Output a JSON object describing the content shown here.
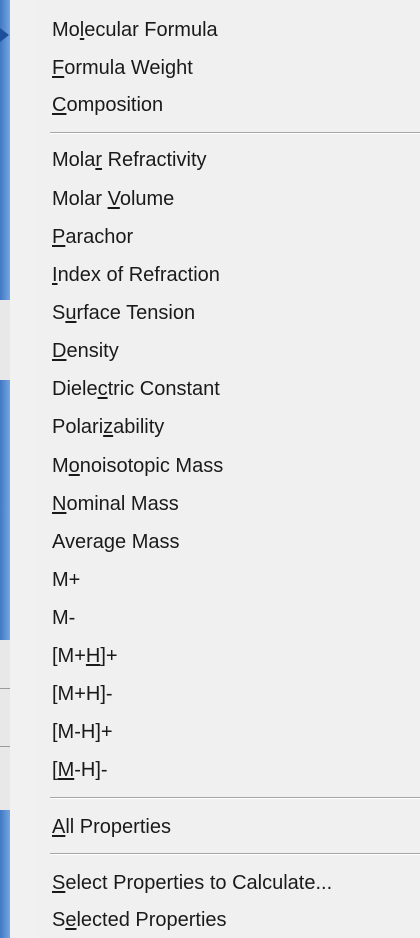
{
  "menu": {
    "group1": [
      {
        "pre": "Mo",
        "u": "l",
        "post": "ecular Formula"
      },
      {
        "pre": "",
        "u": "F",
        "post": "ormula Weight"
      },
      {
        "pre": "",
        "u": "C",
        "post": "omposition"
      }
    ],
    "group2": [
      {
        "pre": "Mola",
        "u": "r",
        "post": " Refractivity"
      },
      {
        "pre": "Molar ",
        "u": "V",
        "post": "olume"
      },
      {
        "pre": "",
        "u": "P",
        "post": "arachor"
      },
      {
        "pre": "",
        "u": "I",
        "post": "ndex of Refraction"
      },
      {
        "pre": "S",
        "u": "u",
        "post": "rface Tension"
      },
      {
        "pre": "",
        "u": "D",
        "post": "ensity"
      },
      {
        "pre": "Diele",
        "u": "c",
        "post": "tric Constant"
      },
      {
        "pre": "Polari",
        "u": "z",
        "post": "ability"
      },
      {
        "pre": "M",
        "u": "o",
        "post": "noisotopic Mass"
      },
      {
        "pre": "",
        "u": "N",
        "post": "ominal Mass"
      },
      {
        "pre": "Avera",
        "u": "g",
        "post": "e Mass"
      },
      {
        "pre": "M+",
        "u": "",
        "post": ""
      },
      {
        "pre": "M-",
        "u": "",
        "post": ""
      },
      {
        "pre": "[M+",
        "u": "H",
        "post": "]+"
      },
      {
        "pre": "[M+H]-",
        "u": "",
        "post": ""
      },
      {
        "pre": "[M-H]+",
        "u": "",
        "post": ""
      },
      {
        "pre": "[",
        "u": "M",
        "post": "-H]-"
      }
    ],
    "group3": [
      {
        "pre": "",
        "u": "A",
        "post": "ll Properties"
      }
    ],
    "group4": [
      {
        "pre": "",
        "u": "S",
        "post": "elect Properties to Calculate..."
      },
      {
        "pre": "S",
        "u": "e",
        "post": "lected Properties"
      }
    ]
  }
}
